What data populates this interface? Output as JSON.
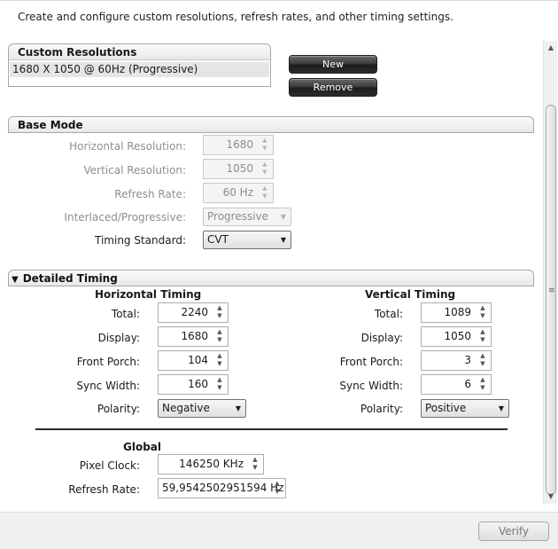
{
  "intro": "Create and configure custom resolutions, refresh rates, and other timing settings.",
  "custom_resolutions": {
    "title": "Custom Resolutions",
    "items": [
      "1680 X 1050 @ 60Hz (Progressive)"
    ],
    "new_label": "New",
    "remove_label": "Remove"
  },
  "base_mode": {
    "title": "Base Mode",
    "horizontal_resolution": {
      "label": "Horizontal Resolution:",
      "value": "1680"
    },
    "vertical_resolution": {
      "label": "Vertical Resolution:",
      "value": "1050"
    },
    "refresh_rate": {
      "label": "Refresh Rate:",
      "value": "60  Hz"
    },
    "scan_type": {
      "label": "Interlaced/Progressive:",
      "value": "Progressive"
    },
    "timing_standard": {
      "label": "Timing Standard:",
      "value": "CVT"
    }
  },
  "detailed_timing": {
    "title": "Detailed Timing",
    "horizontal": {
      "title": "Horizontal Timing",
      "total": {
        "label": "Total:",
        "value": "2240"
      },
      "display": {
        "label": "Display:",
        "value": "1680"
      },
      "front_porch": {
        "label": "Front Porch:",
        "value": "104"
      },
      "sync_width": {
        "label": "Sync Width:",
        "value": "160"
      },
      "polarity": {
        "label": "Polarity:",
        "value": "Negative"
      }
    },
    "vertical": {
      "title": "Vertical Timing",
      "total": {
        "label": "Total:",
        "value": "1089"
      },
      "display": {
        "label": "Display:",
        "value": "1050"
      },
      "front_porch": {
        "label": "Front Porch:",
        "value": "3"
      },
      "sync_width": {
        "label": "Sync Width:",
        "value": "6"
      },
      "polarity": {
        "label": "Polarity:",
        "value": "Positive"
      }
    },
    "global": {
      "title": "Global",
      "pixel_clock": {
        "label": "Pixel Clock:",
        "value": "146250  KHz"
      },
      "refresh_rate": {
        "label": "Refresh Rate:",
        "value": "59,9542502951594  Hz"
      }
    }
  },
  "verify_label": "Verify",
  "icons": {
    "spinner_up": "▲",
    "spinner_down": "▼",
    "dropdown": "▼",
    "collapse": "▼",
    "scroll_up": "▲",
    "scroll_down": "▼",
    "grip": "≡"
  }
}
